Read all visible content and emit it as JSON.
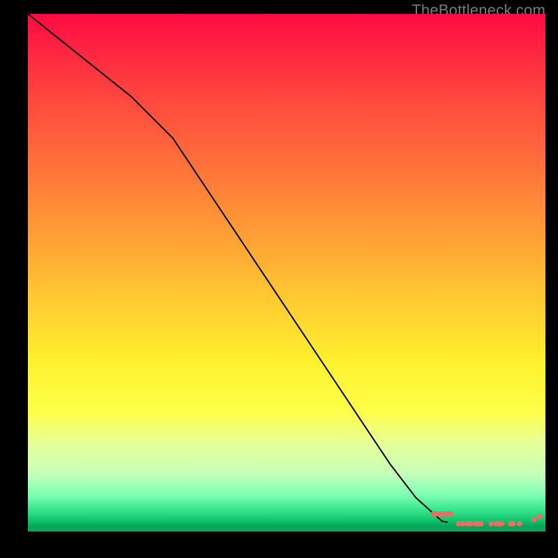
{
  "watermark": "TheBottleneck.com",
  "chart_data": {
    "type": "line",
    "title": "",
    "xlabel": "",
    "ylabel": "",
    "xlim": [
      0,
      100
    ],
    "ylim": [
      0,
      100
    ],
    "grid": false,
    "legend": false,
    "gradient_stops": [
      {
        "pos": 0,
        "color": "#ff0b42"
      },
      {
        "pos": 14,
        "color": "#ff3f3f"
      },
      {
        "pos": 28,
        "color": "#ff6d3b"
      },
      {
        "pos": 42,
        "color": "#ff9c36"
      },
      {
        "pos": 55,
        "color": "#ffc932"
      },
      {
        "pos": 67,
        "color": "#fff02e"
      },
      {
        "pos": 77,
        "color": "#fcff49"
      },
      {
        "pos": 83,
        "color": "#e7ff99"
      },
      {
        "pos": 89,
        "color": "#c5ffba"
      },
      {
        "pos": 93,
        "color": "#7bffb3"
      },
      {
        "pos": 96,
        "color": "#33e28a"
      },
      {
        "pos": 98,
        "color": "#0ec26a"
      },
      {
        "pos": 99,
        "color": "#06a556"
      },
      {
        "pos": 100,
        "color": "#0aa65b"
      }
    ],
    "series": [
      {
        "name": "bottleneck-curve",
        "color": "#000000",
        "x": [
          0,
          5,
          10,
          15,
          20,
          25,
          28,
          30,
          35,
          40,
          45,
          50,
          55,
          60,
          65,
          70,
          75,
          80,
          81
        ],
        "y": [
          100,
          96,
          92,
          88,
          84,
          79,
          76,
          73,
          65.5,
          58,
          50.5,
          43,
          35.5,
          28,
          20.5,
          13,
          6.5,
          2,
          1.8
        ]
      },
      {
        "name": "sample-markers",
        "type": "scatter",
        "color": "#e77064",
        "points": [
          {
            "x": 80.0,
            "y": 3.4,
            "shape": "pill",
            "len": 4.2
          },
          {
            "x": 83.2,
            "y": 1.5,
            "shape": "dot"
          },
          {
            "x": 84.0,
            "y": 1.5,
            "shape": "dot"
          },
          {
            "x": 85.2,
            "y": 1.5,
            "shape": "pill",
            "len": 1.6
          },
          {
            "x": 87.0,
            "y": 1.5,
            "shape": "pill",
            "len": 2.0
          },
          {
            "x": 89.5,
            "y": 1.5,
            "shape": "dot"
          },
          {
            "x": 91.0,
            "y": 1.5,
            "shape": "pill",
            "len": 2.0
          },
          {
            "x": 93.5,
            "y": 1.5,
            "shape": "pill",
            "len": 1.4
          },
          {
            "x": 95.0,
            "y": 1.5,
            "shape": "dot"
          },
          {
            "x": 97.8,
            "y": 2.3,
            "shape": "dot"
          },
          {
            "x": 98.8,
            "y": 2.9,
            "shape": "dot"
          }
        ]
      }
    ]
  }
}
